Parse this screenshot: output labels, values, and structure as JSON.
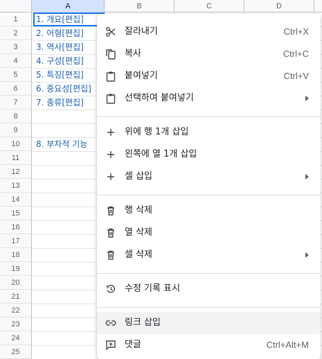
{
  "columns": [
    "A",
    "B",
    "C",
    "D"
  ],
  "rows": [
    "1",
    "2",
    "3",
    "4",
    "5",
    "6",
    "7",
    "8",
    "9",
    "10",
    "11",
    "12",
    "13",
    "14",
    "15",
    "16",
    "17",
    "18",
    "19",
    "20",
    "21",
    "22",
    "23",
    "24",
    "25"
  ],
  "cells": {
    "a1": "1. 개요[편집]",
    "a2": "2. 어형[편집]",
    "a3": "3. 역사[편집]",
    "a4": "4. 구성[편집]",
    "a5": "5. 특징[편집]",
    "a6": "6. 중요성[편집]",
    "a7": "7. 종류[편집]",
    "a10": "8. 부차적 기능"
  },
  "menu": {
    "cut": {
      "label": "잘라내기",
      "shortcut": "Ctrl+X",
      "icon": "scissors-icon"
    },
    "copy": {
      "label": "복사",
      "shortcut": "Ctrl+C",
      "icon": "copy-icon"
    },
    "paste": {
      "label": "붙여넣기",
      "shortcut": "Ctrl+V",
      "icon": "clipboard-icon"
    },
    "paste_special": {
      "label": "선택하여 붙여넣기",
      "icon": "clipboard-icon"
    },
    "insert_row_above": {
      "label": "위에 행 1개 삽입",
      "icon": "plus-icon"
    },
    "insert_col_left": {
      "label": "왼쪽에 열 1개 삽입",
      "icon": "plus-icon"
    },
    "insert_cells": {
      "label": "셀 삽입",
      "icon": "plus-icon"
    },
    "delete_row": {
      "label": "행 삭제",
      "icon": "trash-icon"
    },
    "delete_col": {
      "label": "열 삭제",
      "icon": "trash-icon"
    },
    "delete_cells": {
      "label": "셀 삭제",
      "icon": "trash-icon"
    },
    "show_edit_history": {
      "label": "수정 기록 표시",
      "icon": "history-icon"
    },
    "insert_link": {
      "label": "링크 삽입",
      "icon": "link-icon"
    },
    "comment": {
      "label": "댓글",
      "shortcut": "Ctrl+Alt+M",
      "icon": "comment-add-icon"
    }
  },
  "colors": {
    "link_text": "#1a5fb4",
    "selection": "#1a73e8",
    "header_bg": "#f8f9fa",
    "menu_highlight": "#f1f3f4"
  }
}
